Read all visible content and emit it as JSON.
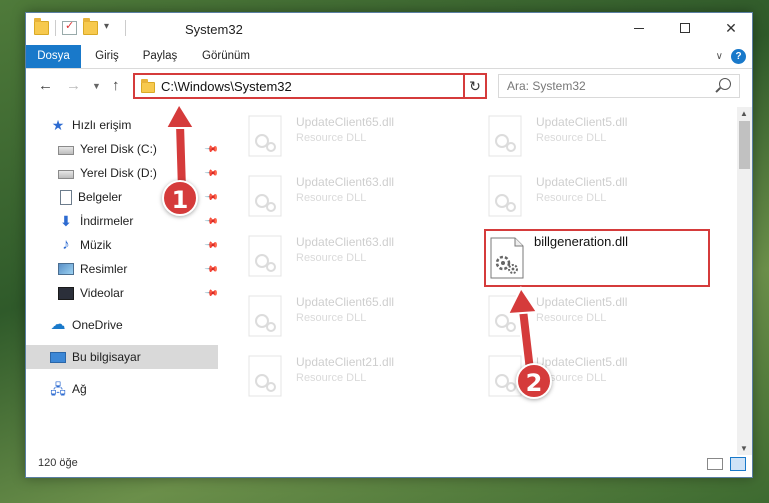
{
  "window": {
    "title": "System32"
  },
  "ribbon": {
    "tabs": [
      "Dosya",
      "Giriş",
      "Paylaş",
      "Görünüm"
    ]
  },
  "address": {
    "path": "C:\\Windows\\System32",
    "search_placeholder": "Ara: System32"
  },
  "sidebar": {
    "items": [
      {
        "label": "Hızlı erişim",
        "icon": "star-icon"
      },
      {
        "label": "Yerel Disk (C:)",
        "icon": "drive-icon",
        "pinned": true
      },
      {
        "label": "Yerel Disk (D:)",
        "icon": "drive-icon",
        "pinned": true
      },
      {
        "label": "Belgeler",
        "icon": "document-icon",
        "pinned": true
      },
      {
        "label": "İndirmeler",
        "icon": "download-icon",
        "pinned": true
      },
      {
        "label": "Müzik",
        "icon": "music-icon",
        "pinned": true
      },
      {
        "label": "Resimler",
        "icon": "pictures-icon",
        "pinned": true
      },
      {
        "label": "Videolar",
        "icon": "videos-icon",
        "pinned": true
      },
      {
        "label": "OneDrive",
        "icon": "cloud-icon"
      },
      {
        "label": "Bu bilgisayar",
        "icon": "computer-icon",
        "selected": true
      },
      {
        "label": "Ağ",
        "icon": "network-icon"
      }
    ]
  },
  "files": [
    {
      "name": "UpdateClient65.dll",
      "type": "Resource DLL"
    },
    {
      "name": "UpdateClient5.dll",
      "type": "Resource DLL"
    },
    {
      "name": "UpdateClient63.dll",
      "type": "Resource DLL"
    },
    {
      "name": "UpdateClient5.dll",
      "type": "Resource DLL"
    },
    {
      "name": "UpdateClient63.dll",
      "type": "Resource DLL"
    },
    {
      "name": "billgeneration.dll",
      "type": "",
      "highlighted": true
    },
    {
      "name": "UpdateClient65.dll",
      "type": "Resource DLL"
    },
    {
      "name": "UpdateClient5.dll",
      "type": "Resource DLL"
    },
    {
      "name": "UpdateClient21.dll",
      "type": "Resource DLL"
    },
    {
      "name": "UpdateClient5.dll",
      "type": "Resource DLL"
    }
  ],
  "status": {
    "item_count": "120 öğe"
  },
  "annotations": {
    "step1": "1",
    "step2": "2",
    "color": "#d53b3b"
  }
}
